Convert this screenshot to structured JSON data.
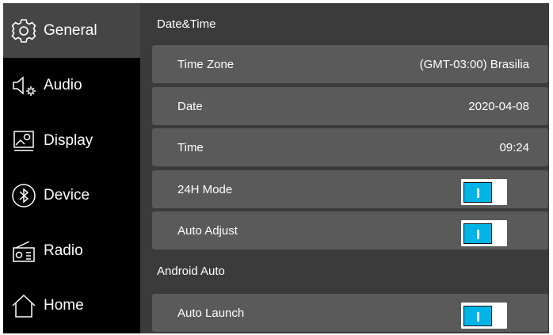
{
  "sidebar": {
    "items": [
      {
        "label": "General",
        "icon": "gear-icon",
        "active": true
      },
      {
        "label": "Audio",
        "icon": "speaker-settings-icon",
        "active": false
      },
      {
        "label": "Display",
        "icon": "display-icon",
        "active": false
      },
      {
        "label": "Device",
        "icon": "bluetooth-icon",
        "active": false
      },
      {
        "label": "Radio",
        "icon": "radio-icon",
        "active": false
      },
      {
        "label": "Home",
        "icon": "home-icon",
        "active": false
      }
    ]
  },
  "main": {
    "section_datetime": "Date&Time",
    "section_android": "Android Auto",
    "rows": [
      {
        "label": "Time Zone",
        "value": "(GMT-03:00) Brasilia"
      },
      {
        "label": "Date",
        "value": "2020-04-08"
      },
      {
        "label": "Time",
        "value": "09:24"
      },
      {
        "label": "24H Mode",
        "toggle": true
      },
      {
        "label": "Auto Adjust",
        "toggle": true
      },
      {
        "label": "Auto Launch",
        "toggle": true
      }
    ]
  },
  "colors": {
    "accent": "#00b4e6",
    "active_bg": "#454545",
    "row_bg": "#5a5a5a",
    "panel_bg": "#3b3b3b"
  }
}
